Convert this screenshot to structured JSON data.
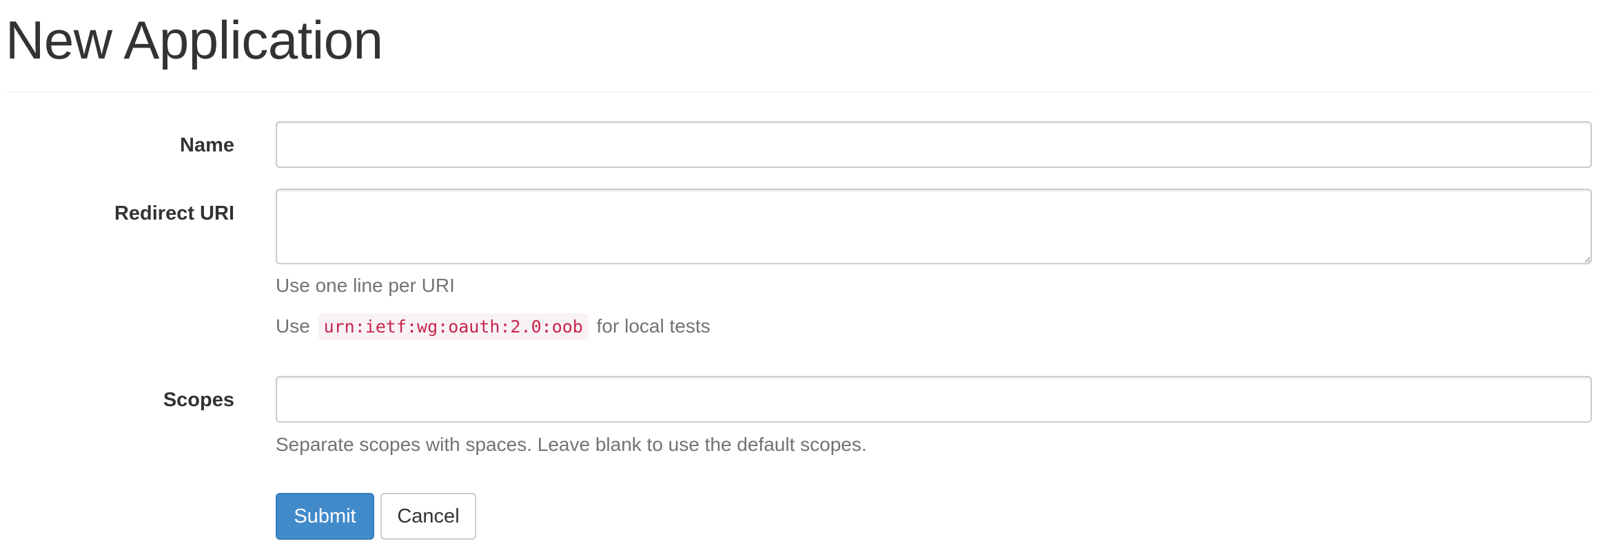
{
  "page": {
    "title": "New Application"
  },
  "form": {
    "name": {
      "label": "Name",
      "value": ""
    },
    "redirect_uri": {
      "label": "Redirect URI",
      "value": "",
      "help_line": "Use one line per URI",
      "help_prefix": "Use",
      "help_code": "urn:ietf:wg:oauth:2.0:oob",
      "help_suffix": "for local tests"
    },
    "scopes": {
      "label": "Scopes",
      "value": "",
      "help": "Separate scopes with spaces. Leave blank to use the default scopes."
    }
  },
  "actions": {
    "submit_label": "Submit",
    "cancel_label": "Cancel"
  },
  "colors": {
    "primary": "#428bca",
    "code_text": "#c7254e",
    "code_bg": "#f9f2f4",
    "help_text": "#737373"
  }
}
